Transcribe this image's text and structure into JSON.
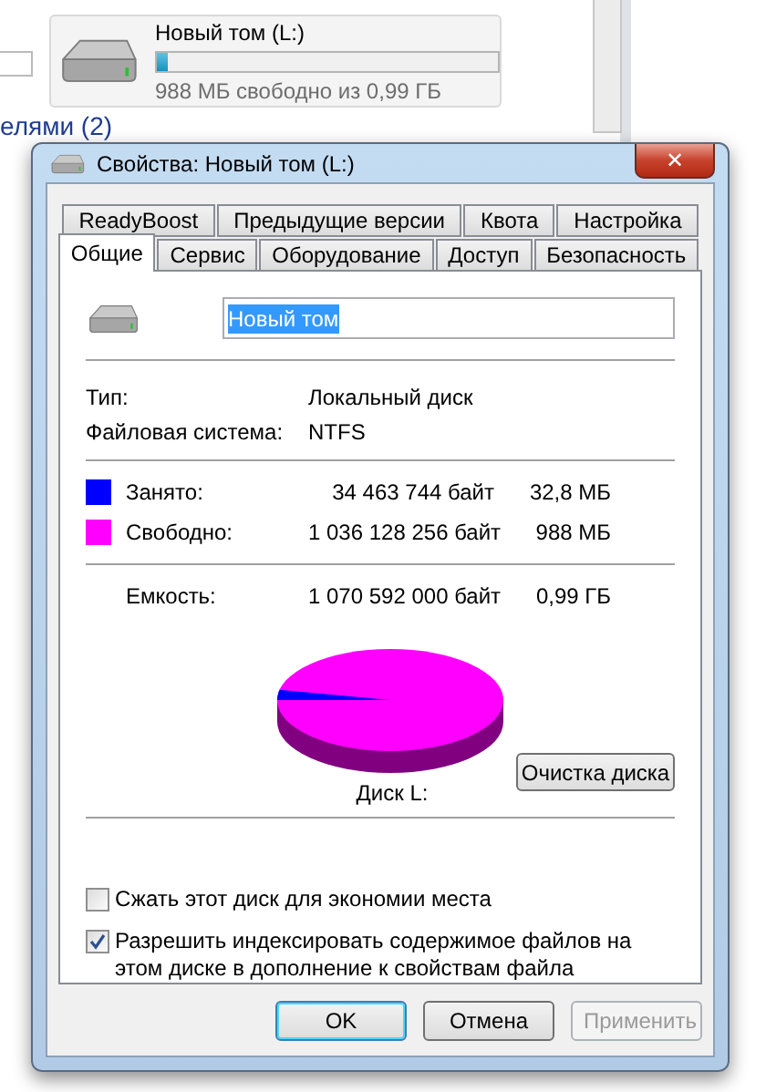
{
  "background": {
    "drive": {
      "name": "Новый том (L:)",
      "level": 0.032,
      "caption": "988 МБ свободно из 0,99 ГБ"
    },
    "link": "елями (2)"
  },
  "dialog": {
    "title": "Свойства: Новый том (L:)",
    "close": "✕",
    "tab_rows": [
      [
        {
          "label": "ReadyBoost",
          "selected": false
        },
        {
          "label": "Предыдущие версии",
          "selected": false
        },
        {
          "label": "Квота",
          "selected": false
        },
        {
          "label": "Настройка",
          "selected": false
        }
      ],
      [
        {
          "label": "Общие",
          "selected": true
        },
        {
          "label": "Сервис",
          "selected": false
        },
        {
          "label": "Оборудование",
          "selected": false
        },
        {
          "label": "Доступ",
          "selected": false
        },
        {
          "label": "Безопасность",
          "selected": false
        }
      ]
    ],
    "name_value": "Новый том",
    "info": [
      {
        "label": "Тип:",
        "value": "Локальный диск"
      },
      {
        "label": "Файловая система:",
        "value": "NTFS"
      }
    ],
    "usage": [
      {
        "label": "Занято:",
        "color": "#0000ff",
        "bytes": "34 463 744 байт",
        "size": "32,8 МБ"
      },
      {
        "label": "Свободно:",
        "color": "#ff00ff",
        "bytes": "1 036 128 256 байт",
        "size": "988 МБ"
      }
    ],
    "capacity": {
      "label": "Емкость:",
      "bytes": "1 070 592 000 байт",
      "size": "0,99 ГБ"
    },
    "disk_label": "Диск L:",
    "cleanup_button": "Очистка диска",
    "options": [
      {
        "label": "Сжать этот диск для экономии места",
        "checked": false
      },
      {
        "label": "Разрешить индексировать содержимое файлов на этом диске в дополнение к свойствам файла",
        "checked": true
      }
    ],
    "buttons": [
      {
        "label": "OK",
        "disabled": false,
        "default": true
      },
      {
        "label": "Отмена",
        "disabled": false,
        "default": false
      },
      {
        "label": "Применить",
        "disabled": true,
        "default": false
      }
    ]
  }
}
